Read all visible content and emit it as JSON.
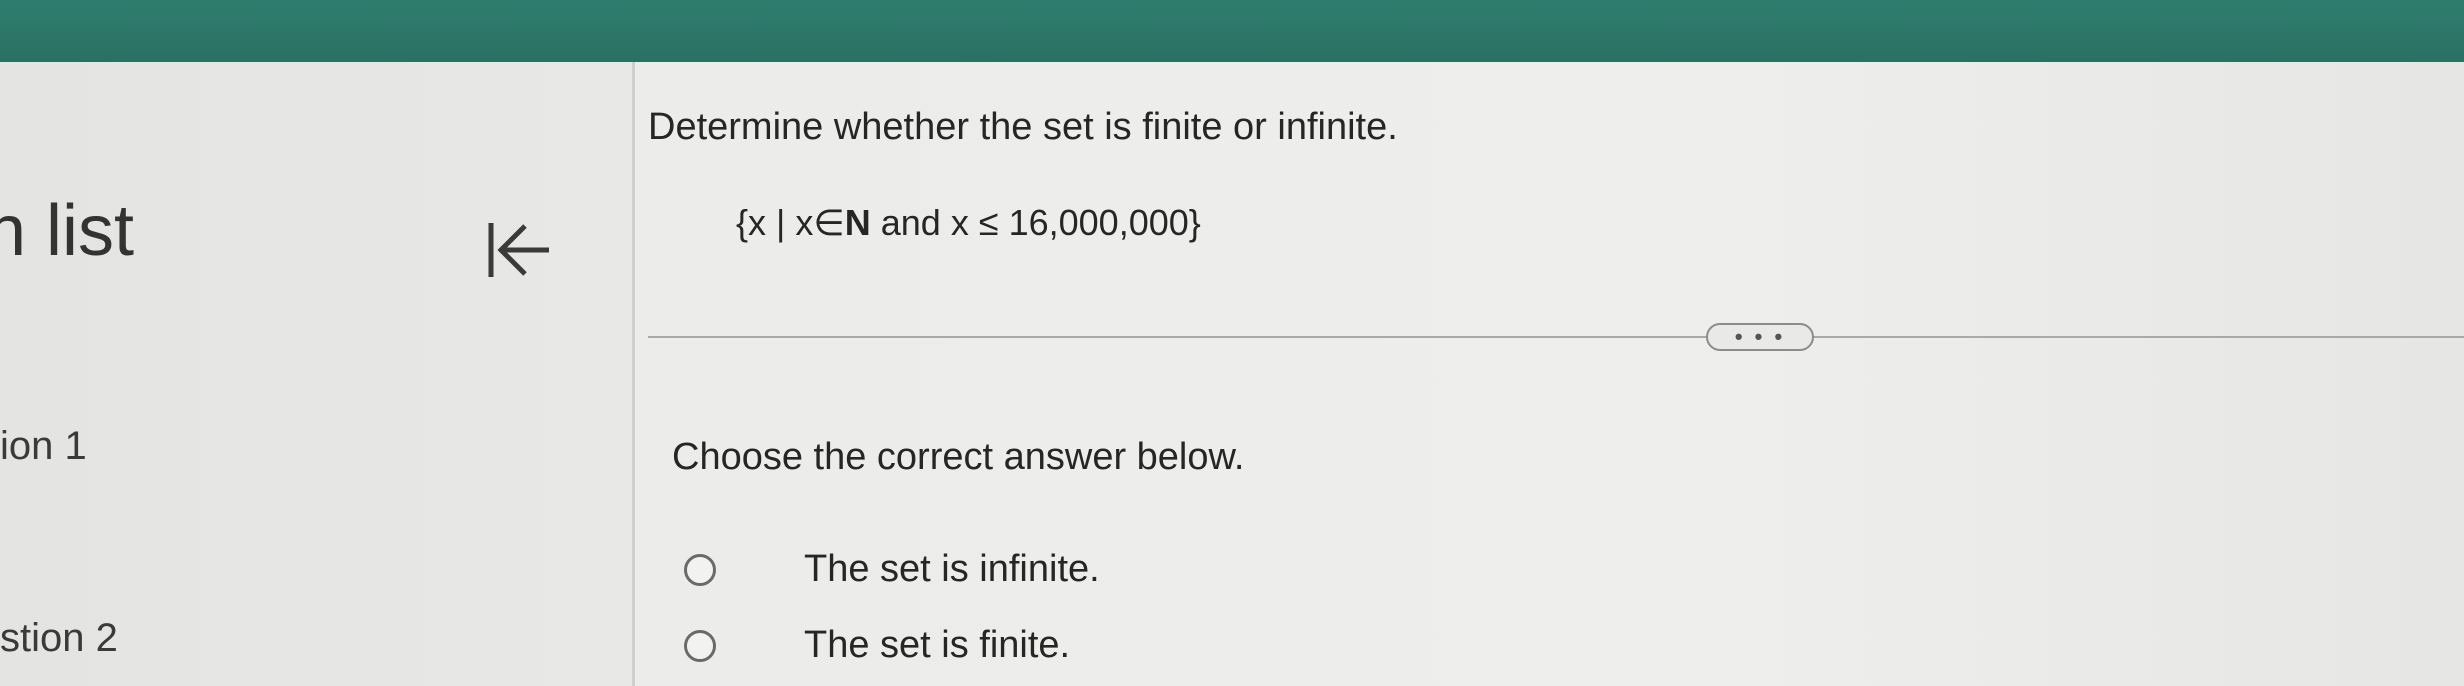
{
  "sidebar": {
    "title": "n list",
    "items": [
      {
        "label": "ion 1"
      },
      {
        "label": "stion 2"
      }
    ],
    "collapse_icon": "collapse-left-icon"
  },
  "question": {
    "prompt": "Determine whether the set is finite or infinite.",
    "set_expression": {
      "open": "{x | x∈",
      "bold": "N",
      "rest": " and x ≤ 16,000,000}"
    },
    "more_label": "• • •",
    "instruction": "Choose the correct answer below.",
    "options": [
      {
        "label": "The set is infinite."
      },
      {
        "label": "The set is finite."
      }
    ]
  },
  "colors": {
    "header": "#2f7d6e",
    "background": "#e9e9e7"
  }
}
